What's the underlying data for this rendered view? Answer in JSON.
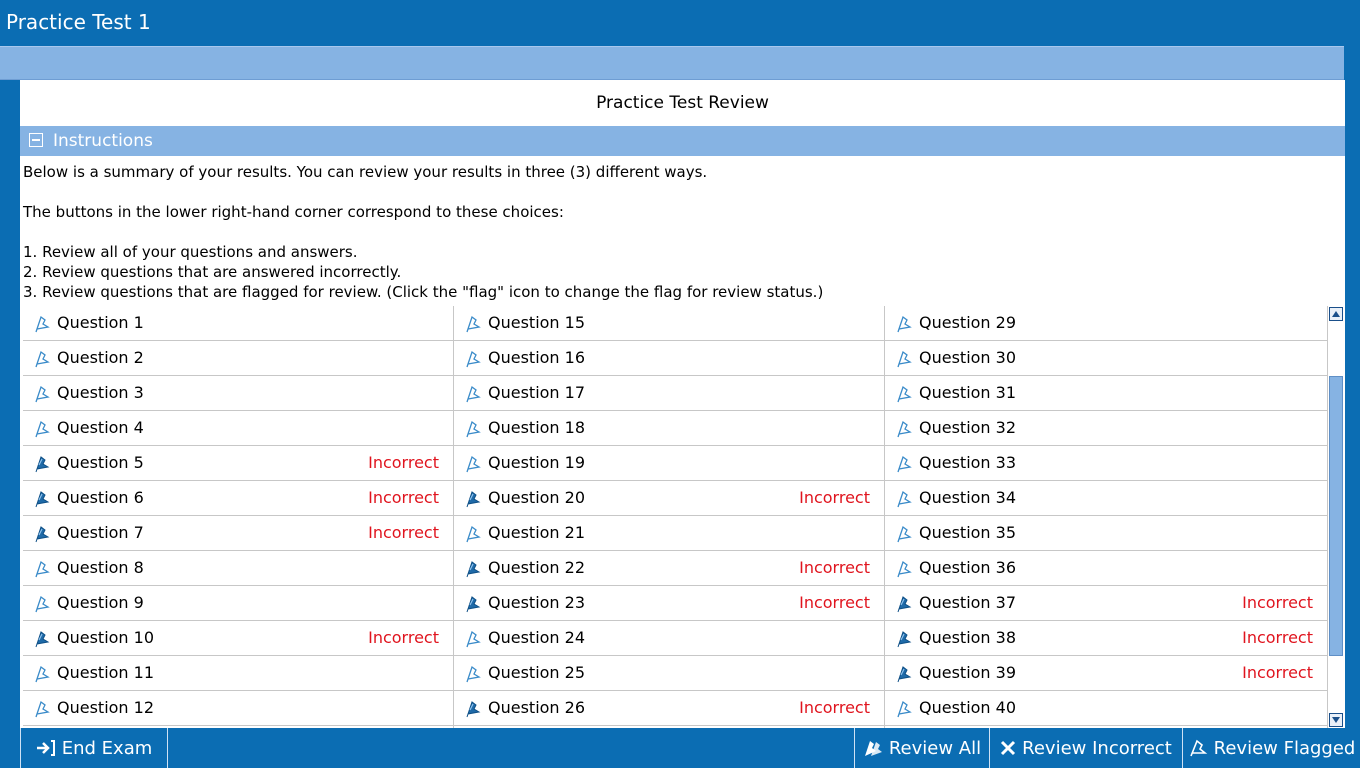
{
  "window": {
    "title": "Practice Test 1"
  },
  "page": {
    "title": "Practice Test Review"
  },
  "instructions": {
    "header": "Instructions",
    "lines": [
      "Below is a summary of your results. You can review your results in three (3) different ways.",
      "The buttons in the lower right-hand corner correspond to these choices:",
      "1. Review all of your questions and answers.",
      "2. Review questions that are answered incorrectly.",
      "3. Review questions that are flagged for review. (Click the \"flag\" icon to change the flag for review status.)"
    ]
  },
  "questions": {
    "columns": [
      [
        {
          "label": "Question 1",
          "status": "",
          "answered": false
        },
        {
          "label": "Question 2",
          "status": "",
          "answered": false
        },
        {
          "label": "Question 3",
          "status": "",
          "answered": false
        },
        {
          "label": "Question 4",
          "status": "",
          "answered": false
        },
        {
          "label": "Question 5",
          "status": "Incorrect",
          "answered": true
        },
        {
          "label": "Question 6",
          "status": "Incorrect",
          "answered": true
        },
        {
          "label": "Question 7",
          "status": "Incorrect",
          "answered": true
        },
        {
          "label": "Question 8",
          "status": "",
          "answered": false
        },
        {
          "label": "Question 9",
          "status": "",
          "answered": false
        },
        {
          "label": "Question 10",
          "status": "Incorrect",
          "answered": true
        },
        {
          "label": "Question 11",
          "status": "",
          "answered": false
        },
        {
          "label": "Question 12",
          "status": "",
          "answered": false
        }
      ],
      [
        {
          "label": "Question 15",
          "status": "",
          "answered": false
        },
        {
          "label": "Question 16",
          "status": "",
          "answered": false
        },
        {
          "label": "Question 17",
          "status": "",
          "answered": false
        },
        {
          "label": "Question 18",
          "status": "",
          "answered": false
        },
        {
          "label": "Question 19",
          "status": "",
          "answered": false
        },
        {
          "label": "Question 20",
          "status": "Incorrect",
          "answered": true
        },
        {
          "label": "Question 21",
          "status": "",
          "answered": false
        },
        {
          "label": "Question 22",
          "status": "Incorrect",
          "answered": true
        },
        {
          "label": "Question 23",
          "status": "Incorrect",
          "answered": true
        },
        {
          "label": "Question 24",
          "status": "",
          "answered": false
        },
        {
          "label": "Question 25",
          "status": "",
          "answered": false
        },
        {
          "label": "Question 26",
          "status": "Incorrect",
          "answered": true
        }
      ],
      [
        {
          "label": "Question 29",
          "status": "",
          "answered": false
        },
        {
          "label": "Question 30",
          "status": "",
          "answered": false
        },
        {
          "label": "Question 31",
          "status": "",
          "answered": false
        },
        {
          "label": "Question 32",
          "status": "",
          "answered": false
        },
        {
          "label": "Question 33",
          "status": "",
          "answered": false
        },
        {
          "label": "Question 34",
          "status": "",
          "answered": false
        },
        {
          "label": "Question 35",
          "status": "",
          "answered": false
        },
        {
          "label": "Question 36",
          "status": "",
          "answered": false
        },
        {
          "label": "Question 37",
          "status": "Incorrect",
          "answered": true
        },
        {
          "label": "Question 38",
          "status": "Incorrect",
          "answered": true
        },
        {
          "label": "Question 39",
          "status": "Incorrect",
          "answered": true
        },
        {
          "label": "Question 40",
          "status": "",
          "answered": false
        }
      ]
    ]
  },
  "buttons": {
    "end_exam": "End Exam",
    "review_all": "Review All",
    "review_incorrect": "Review Incorrect",
    "review_flagged": "Review Flagged"
  },
  "icons": {
    "collapse": "minus-box-icon",
    "flag": "flag-icon",
    "end_exam": "exit-arrow-icon",
    "review_all": "flags-icon",
    "review_incorrect": "x-mark-icon",
    "review_flagged": "flag-icon"
  },
  "colors": {
    "brand": "#0b6db3",
    "header_band": "#86b3e3",
    "incorrect": "#e0141e",
    "flag_outline": "#3a8bc9",
    "flag_filled": "#1f6aa8"
  }
}
